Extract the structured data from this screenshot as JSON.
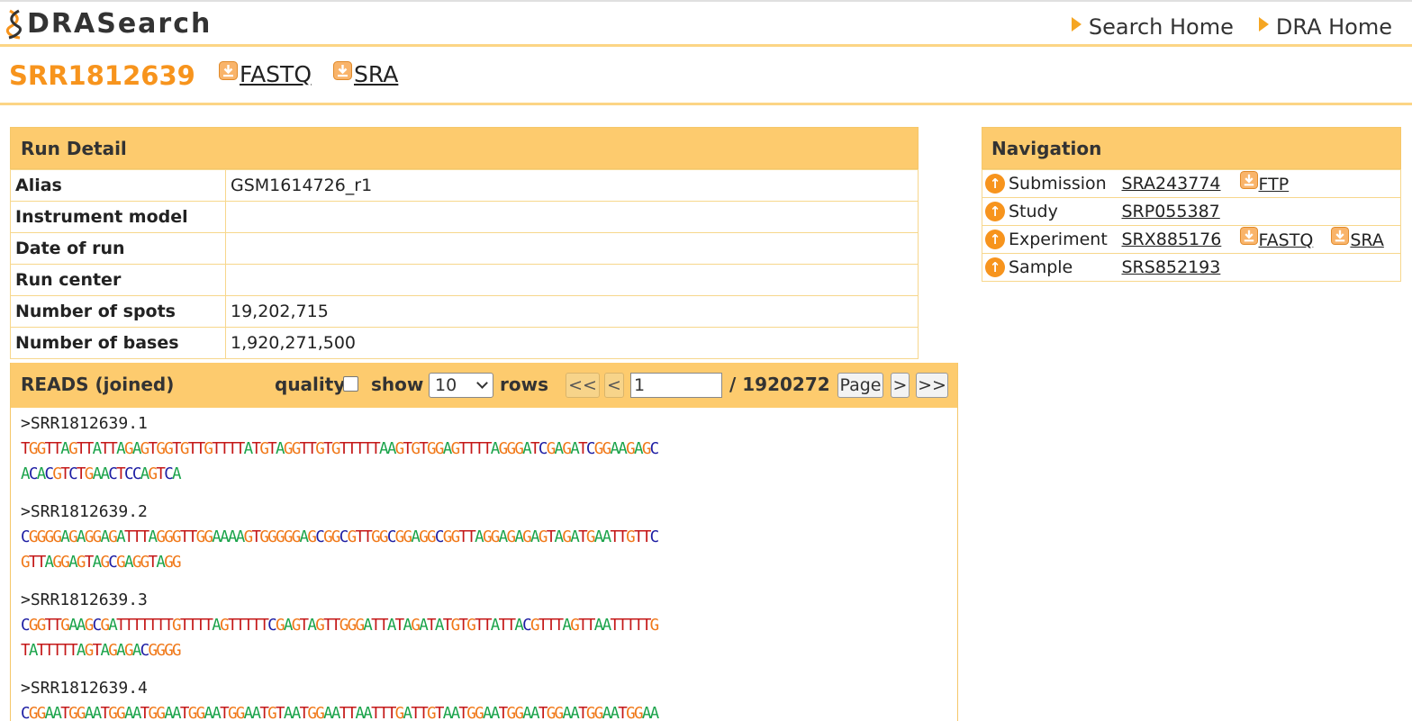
{
  "header": {
    "logo_text": "DRASearch",
    "nav": [
      {
        "label": "Search Home"
      },
      {
        "label": "DRA Home"
      }
    ]
  },
  "titlebar": {
    "run_id": "SRR1812639",
    "downloads": [
      {
        "label": "FASTQ"
      },
      {
        "label": "SRA"
      }
    ]
  },
  "run_detail": {
    "title": "Run Detail",
    "rows": [
      {
        "key": "Alias",
        "value": "GSM1614726_r1"
      },
      {
        "key": "Instrument model",
        "value": ""
      },
      {
        "key": "Date of run",
        "value": ""
      },
      {
        "key": "Run center",
        "value": ""
      },
      {
        "key": "Number of spots",
        "value": "19,202,715"
      },
      {
        "key": "Number of bases",
        "value": "1,920,271,500"
      }
    ]
  },
  "navigation": {
    "title": "Navigation",
    "rows": [
      {
        "label": "Submission",
        "accession": "SRA243774",
        "links": [
          "FTP"
        ]
      },
      {
        "label": "Study",
        "accession": "SRP055387",
        "links": []
      },
      {
        "label": "Experiment",
        "accession": "SRX885176",
        "links": [
          "FASTQ",
          "SRA"
        ]
      },
      {
        "label": "Sample",
        "accession": "SRS852193",
        "links": []
      }
    ]
  },
  "reads": {
    "title": "READS (joined)",
    "quality_label": "quality",
    "quality_checked": false,
    "show_label": "show",
    "rows_label": "rows",
    "rows_value": "10",
    "first_label": "<<",
    "prev_label": "<",
    "page_value": "1",
    "total_pages": "/ 1920272",
    "page_button": "Page",
    "next_label": ">",
    "last_label": ">>",
    "items": [
      {
        "id": ">SRR1812639.1",
        "lines": [
          "TGGTTAGTTATTAGAGTGGTGTTGTTTTATGTAGGTTGTGTTTTTAAGTGTGGAGTTTTAGGGATCGAGATCGGAAGAGC",
          "ACACGTCTGAACTCCAGTCA"
        ]
      },
      {
        "id": ">SRR1812639.2",
        "lines": [
          "CGGGGAGAGGAGATTTAGGGTTGGAAAAGTGGGGGAGCGGCGTTGGCGGAGGCGGTTAGGAGAGAGTAGATGAATTGTTC",
          "GTTAGGAGTAGCGAGGTAGG"
        ]
      },
      {
        "id": ">SRR1812639.3",
        "lines": [
          "CGGTTGAAGCGATTTTTTTGTTTTAGTTTTTCGAGTAGTTGGGATTATAGATATGTGTTATTACGTTTAGTTAATTTTTG",
          "TATTTTTAGTAGAGACGGGG"
        ]
      },
      {
        "id": ">SRR1812639.4",
        "lines": [
          "CGGAATGGAATGGAATGGAATGGAATGGAATGTAATGGAATTAATTTGATTGTAATGGAATGGAATGGAATGGAATGGAA"
        ]
      }
    ]
  }
}
